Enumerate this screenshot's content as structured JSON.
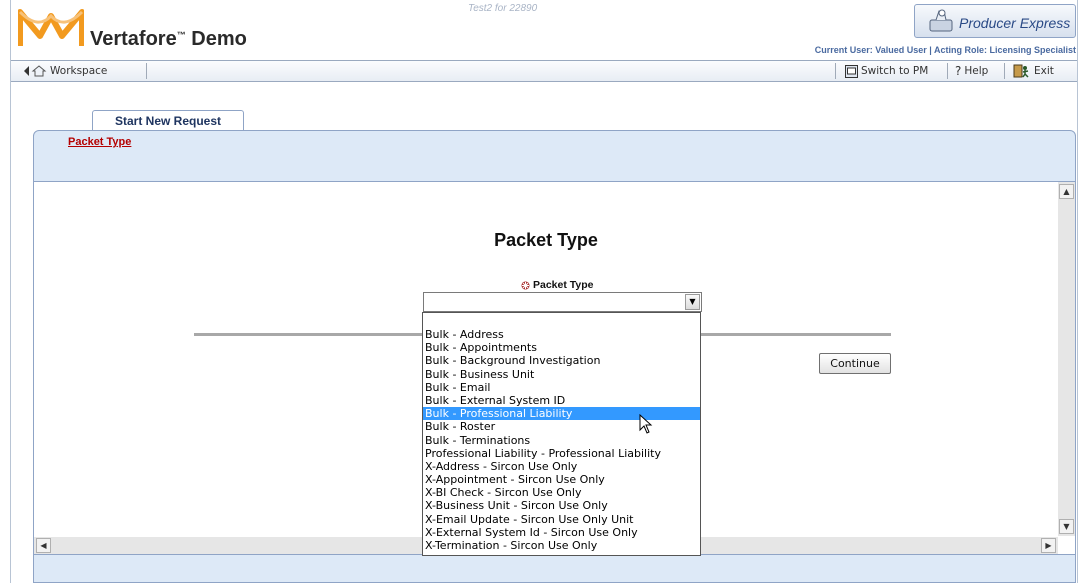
{
  "header": {
    "brand": "Vertafore",
    "brand_tm": "™",
    "brand_suffix": " Demo",
    "subtitle": "Test2 for 22890",
    "product": "Producer Express",
    "user_line": "Current User: Valued User  |  Acting Role: Licensing Specialist"
  },
  "toolbar": {
    "workspace_label": "Workspace",
    "switch_label": "Switch to PM",
    "help_label": "Help",
    "exit_label": "Exit"
  },
  "tabs": [
    {
      "label": "Start New Request"
    }
  ],
  "breadcrumb": "Packet Type",
  "form": {
    "heading": "Packet Type",
    "field_label": "Packet Type",
    "selected_value": "",
    "continue_label": "Continue"
  },
  "dropdown": {
    "options": [
      "Bulk - Address",
      "Bulk - Appointments",
      "Bulk - Background Investigation",
      "Bulk - Business Unit",
      "Bulk - Email",
      "Bulk - External System ID",
      "Bulk - Professional Liability",
      "Bulk - Roster",
      "Bulk - Terminations",
      "Professional Liability - Professional Liability",
      "X-Address - Sircon Use Only",
      "X-Appointment - Sircon Use Only",
      "X-BI Check - Sircon Use Only",
      "X-Business Unit - Sircon Use Only",
      "X-Email Update - Sircon Use Only Unit",
      "X-External System Id - Sircon Use Only",
      "X-Termination - Sircon Use Only"
    ],
    "highlighted": "Bulk - Professional Liability"
  },
  "colors": {
    "panel": "#dde9f7",
    "border": "#8fa4c6",
    "breadcrumb": "#b40000",
    "highlight": "#3399ff",
    "logo_orange": "#f29a1f"
  }
}
